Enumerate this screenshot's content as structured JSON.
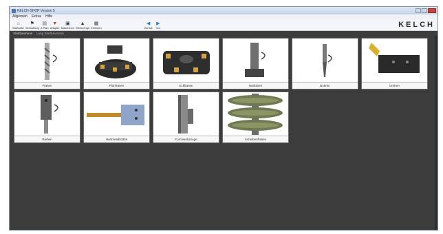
{
  "window": {
    "title": "KELCH-SHOP Version 5"
  },
  "menu": [
    "Allgemein",
    "Extras",
    "Hilfe"
  ],
  "toolbar": [
    {
      "label": "Startseite",
      "icon": "home-icon"
    },
    {
      "label": "Verwaltung",
      "icon": "flag-icon"
    },
    {
      "label": "Z-Plan",
      "icon": "document-icon"
    },
    {
      "label": "Adapter",
      "icon": "adapter-icon"
    },
    {
      "label": "Maschinen",
      "icon": "machine-icon"
    },
    {
      "label": "Werkzeuge",
      "icon": "tool-icon"
    },
    {
      "label": "Einlesen",
      "icon": "import-icon"
    },
    {
      "label": "Zurück",
      "icon": "back-icon"
    },
    {
      "label": "Vor",
      "icon": "forward-icon"
    }
  ],
  "brand": {
    "logo_text": "KELCH"
  },
  "tabs": [
    "Startbaumenü",
    "Lang Startbaumenü"
  ],
  "tiles": [
    {
      "label": "Fräsen",
      "icon": "drill-bit-icon"
    },
    {
      "label": "Planfräsen",
      "icon": "face-mill-icon"
    },
    {
      "label": "Eckfräsen",
      "icon": "shoulder-mill-icon"
    },
    {
      "label": "Nutfräsen",
      "icon": "t-slot-cutter-icon"
    },
    {
      "label": "Bohren",
      "icon": "twist-drill-icon"
    },
    {
      "label": "Drehen",
      "icon": "turning-tool-icon"
    },
    {
      "label": "Reiben",
      "icon": "reamer-icon"
    },
    {
      "label": "Hartmetallstäbe",
      "icon": "carbide-rod-icon"
    },
    {
      "label": "Formwerkzeuge",
      "icon": "form-tool-icon"
    },
    {
      "label": "Scheibenfräsen",
      "icon": "disc-cutter-icon"
    }
  ]
}
